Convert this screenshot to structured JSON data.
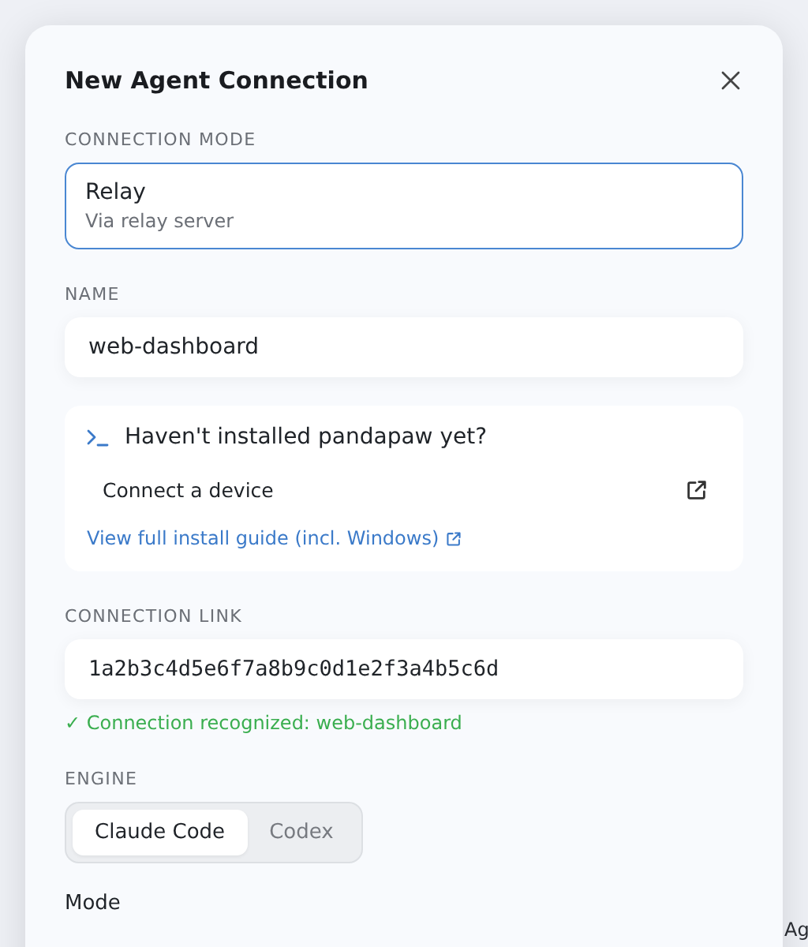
{
  "background_text": "Ag",
  "dialog": {
    "title": "New Agent Connection",
    "connection_mode": {
      "label": "CONNECTION MODE",
      "option": {
        "title": "Relay",
        "subtitle": "Via relay server",
        "selected": true
      }
    },
    "name": {
      "label": "NAME",
      "value": "web-dashboard"
    },
    "install_card": {
      "heading": "Haven't installed pandapaw yet?",
      "action": "Connect a device",
      "link": "View full install guide (incl. Windows)"
    },
    "connection_link": {
      "label": "CONNECTION LINK",
      "value": "1a2b3c4d5e6f7a8b9c0d1e2f3a4b5c6d",
      "status": "✓ Connection recognized: web-dashboard"
    },
    "engine": {
      "label": "ENGINE",
      "options": [
        {
          "label": "Claude Code",
          "selected": true
        },
        {
          "label": "Codex",
          "selected": false
        }
      ]
    },
    "mode": {
      "label": "Mode"
    }
  }
}
